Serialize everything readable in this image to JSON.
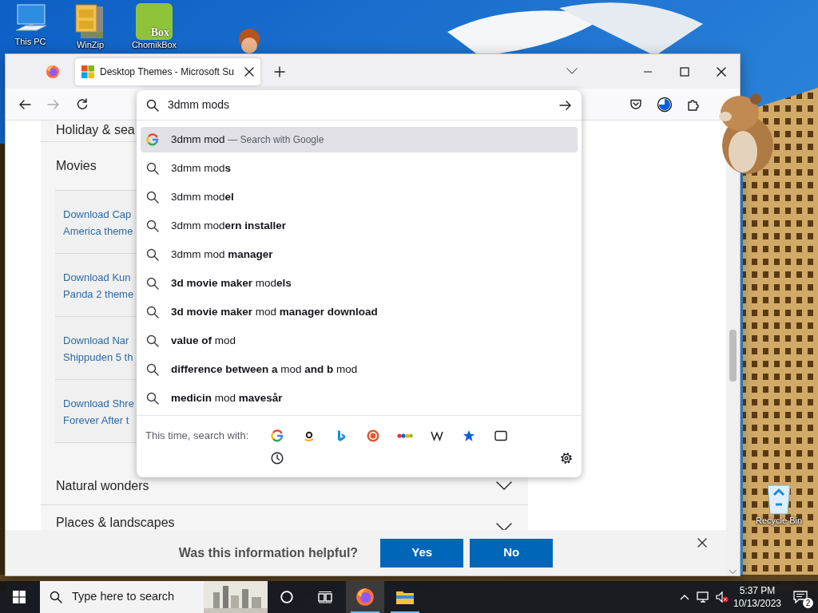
{
  "desktop": {
    "icons": [
      {
        "kind": "pc",
        "label": "This PC"
      },
      {
        "kind": "winzip",
        "label": "WinZip"
      },
      {
        "kind": "chomikbox",
        "label": "ChomikBox",
        "icon_text": "Box"
      },
      {
        "kind": "recycle",
        "label": "Recycle Bin"
      }
    ]
  },
  "browser": {
    "tabs": [
      {
        "title": "Desktop Themes - Microsoft Su",
        "selected": true
      }
    ],
    "address": {
      "value": "3dmm mods"
    },
    "suggestions": [
      {
        "kind": "engine",
        "text": "3dmm mod",
        "note": "— Search with Google",
        "selected": true
      },
      {
        "kind": "search",
        "text": "3dmm mod**s**",
        "selected": false
      },
      {
        "kind": "search",
        "text": "3dmm mod**el**",
        "selected": false
      },
      {
        "kind": "search",
        "text": "3dmm mod**ern installer**",
        "selected": false
      },
      {
        "kind": "search",
        "text": "3dmm mod **manager**",
        "selected": false
      },
      {
        "kind": "search",
        "text": "**3d movie maker** mod**els**",
        "selected": false
      },
      {
        "kind": "search",
        "text": "**3d movie maker** mod **manager download**",
        "selected": false
      },
      {
        "kind": "search",
        "text": "**value of** mod",
        "selected": false
      },
      {
        "kind": "search",
        "text": "**difference between a** mod **and b** mod",
        "selected": false
      },
      {
        "kind": "search",
        "text": "**medicin** mod **mavesår**",
        "selected": false
      }
    ],
    "search_with": {
      "label": "This time, search with:",
      "engines": [
        {
          "kind": "google"
        },
        {
          "kind": "amazon"
        },
        {
          "kind": "bing"
        },
        {
          "kind": "duckduckgo"
        },
        {
          "kind": "ebay"
        },
        {
          "kind": "wikipedia"
        },
        {
          "kind": "bookmarks"
        },
        {
          "kind": "tabs"
        },
        {
          "kind": "history"
        }
      ]
    }
  },
  "page": {
    "sections": [
      {
        "title": "Holiday & sea",
        "expanded": false
      },
      {
        "title": "Movies",
        "expanded": true,
        "items": [
          {
            "lines": [
              "Download Cap",
              "America theme"
            ]
          },
          {
            "lines": [
              "Download Kun",
              "Panda 2 theme"
            ]
          },
          {
            "lines": [
              "Download Nar",
              "Shippuden 5 th"
            ]
          },
          {
            "lines": [
              "Download Shre",
              "Forever After t"
            ]
          }
        ]
      },
      {
        "title": "Natural wonders",
        "expanded": false,
        "chevron": true
      },
      {
        "title": "Places & landscapes",
        "expanded": false,
        "chevron": true
      }
    ],
    "feedback": {
      "question": "Was this information helpful?",
      "buttons": [
        "Yes",
        "No"
      ]
    }
  },
  "taskbar": {
    "search_placeholder": "Type here to search",
    "apps": [
      {
        "kind": "firefox",
        "selected": true
      },
      {
        "kind": "explorer",
        "selected": false
      }
    ],
    "volume_muted": true,
    "time": "5:37 PM",
    "date": "10/13/2023",
    "notifications": "2"
  }
}
